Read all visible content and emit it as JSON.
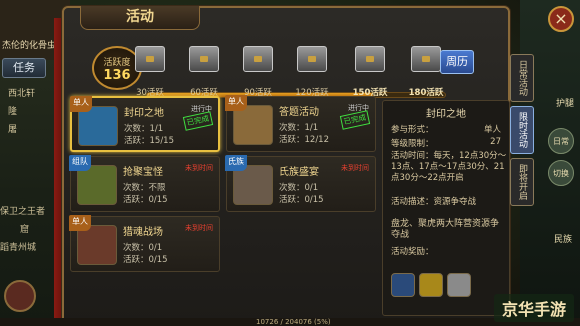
{
  "hud": {
    "player_name": "杰伦的化骨虫",
    "task_button": "任务",
    "side_lines": [
      "西北轩",
      "隆",
      "屠",
      "保卫之王者",
      "蹈青州城",
      "窟"
    ],
    "right_buttons": [
      "日常",
      "切换"
    ],
    "close_glyph": "×",
    "right_labels": [
      "护腿",
      "民族"
    ]
  },
  "panel": {
    "title": "活动",
    "activity": {
      "label": "活跃度",
      "value": "136"
    },
    "week_button": "周历",
    "progress_fraction": 0.76,
    "chests": [
      {
        "label": "30活跃",
        "claimed": false
      },
      {
        "label": "60活跃",
        "claimed": false
      },
      {
        "label": "90活跃",
        "claimed": false
      },
      {
        "label": "120活跃",
        "claimed": false
      },
      {
        "label": "150活跃",
        "claimed": true
      },
      {
        "label": "180活跃",
        "claimed": true
      }
    ]
  },
  "cards": [
    {
      "ribbon": "单人",
      "ribbon_color": "red",
      "title": "封印之地",
      "status": "进行中",
      "status_red": false,
      "stamp": "已完成",
      "line1": "次数：1/1",
      "line2": "活跃：15/15",
      "selected": true,
      "icon_color": "#2a6a9a"
    },
    {
      "ribbon": "单人",
      "ribbon_color": "red",
      "title": "答题活动",
      "status": "进行中",
      "status_red": false,
      "stamp": "已完成",
      "line1": "次数：1/1",
      "line2": "活跃：12/12",
      "selected": false,
      "icon_color": "#8a6a3a"
    },
    {
      "ribbon": "组队",
      "ribbon_color": "blue",
      "title": "抢聚宝怪",
      "status": "未到时间",
      "status_red": true,
      "stamp": "",
      "line1": "次数：不限",
      "line2": "活跃：0/15",
      "selected": false,
      "icon_color": "#5a6a2a"
    },
    {
      "ribbon": "氏族",
      "ribbon_color": "blue",
      "title": "氏族盛宴",
      "status": "未到时间",
      "status_red": true,
      "stamp": "",
      "line1": "次数：0/1",
      "line2": "活跃：0/15",
      "selected": false,
      "icon_color": "#6a5a4a"
    },
    {
      "ribbon": "单人",
      "ribbon_color": "red",
      "title": "猎魂战场",
      "status": "未到时间",
      "status_red": true,
      "stamp": "",
      "line1": "次数：0/1",
      "line2": "活跃：0/15",
      "selected": false,
      "icon_color": "#6a3a2a"
    }
  ],
  "detail": {
    "title": "封印之地",
    "form_label": "参与形式：",
    "form_value": "单人",
    "level_label": "等级限制：",
    "level_value": "27",
    "time_text": "活动时间：每天，12点30分～13点、17点～17点30分、21点30分～22点开启",
    "desc_text": "活动描述：资源争夺战",
    "extra_text": "盘龙、聚虎两大阵营资源争夺战",
    "reward_label": "活动奖励："
  },
  "tabs": [
    {
      "label": "日常活动",
      "active": false
    },
    {
      "label": "限时活动",
      "active": true
    },
    {
      "label": "即将开启",
      "active": false
    }
  ],
  "footer": {
    "exp_text": "10726 / 204076 (5%)",
    "watermark": "京华手游"
  }
}
